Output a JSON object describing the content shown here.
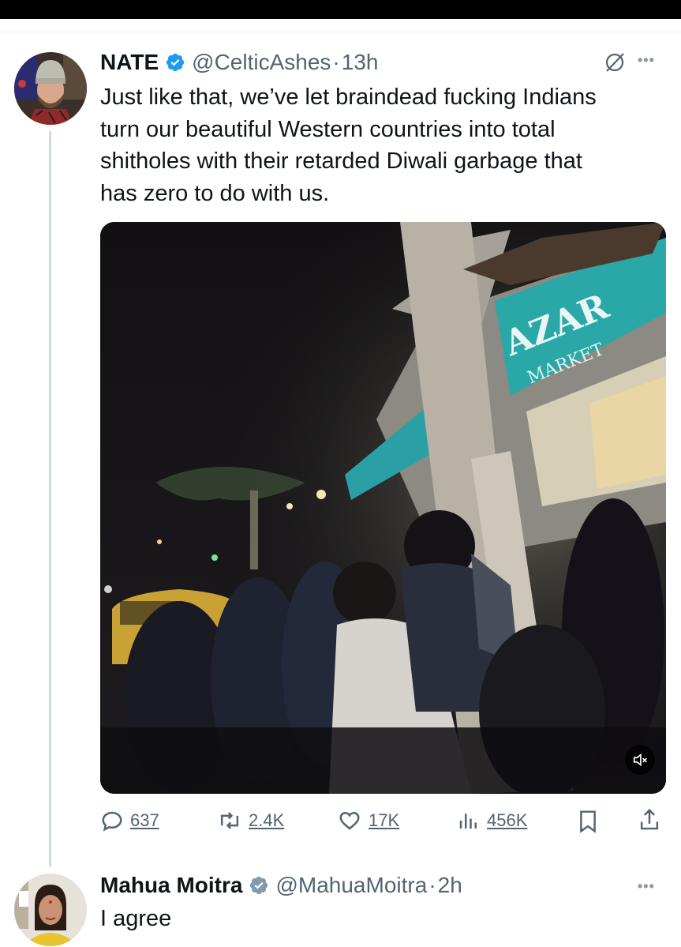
{
  "tweet": {
    "author_name": "NATE",
    "handle": "@CelticAshes",
    "separator": "·",
    "time": "13h",
    "text_lines": [
      "Just like that, we’ve let braindead fucking Indians",
      "turn our beautiful Western countries into total",
      "shitholes with their retarded Diwali garbage that",
      "has zero to do with us."
    ],
    "media": {
      "storefront_sign": "AZAR",
      "storefront_subsign": "MARKET"
    },
    "actions": {
      "replies": "637",
      "reposts": "2.4K",
      "likes": "17K",
      "views": "456K"
    }
  },
  "reply": {
    "author_name": "Mahua Moitra",
    "handle": "@MahuaMoitra",
    "separator": "·",
    "time": "2h",
    "text": "I agree"
  },
  "icons": {
    "verified": "verified-check-icon",
    "grok": "grok-icon",
    "more": "more-dots-icon",
    "mute": "mute-speaker-icon",
    "reply": "reply-bubble-icon",
    "repost": "repost-icon",
    "like": "heart-icon",
    "views": "views-bars-icon",
    "bookmark": "bookmark-icon",
    "share": "share-icon"
  },
  "colors": {
    "verified": "#1d9bf0",
    "text": "#0f1419",
    "secondary": "#536471",
    "thread_line": "#cfd9de"
  }
}
